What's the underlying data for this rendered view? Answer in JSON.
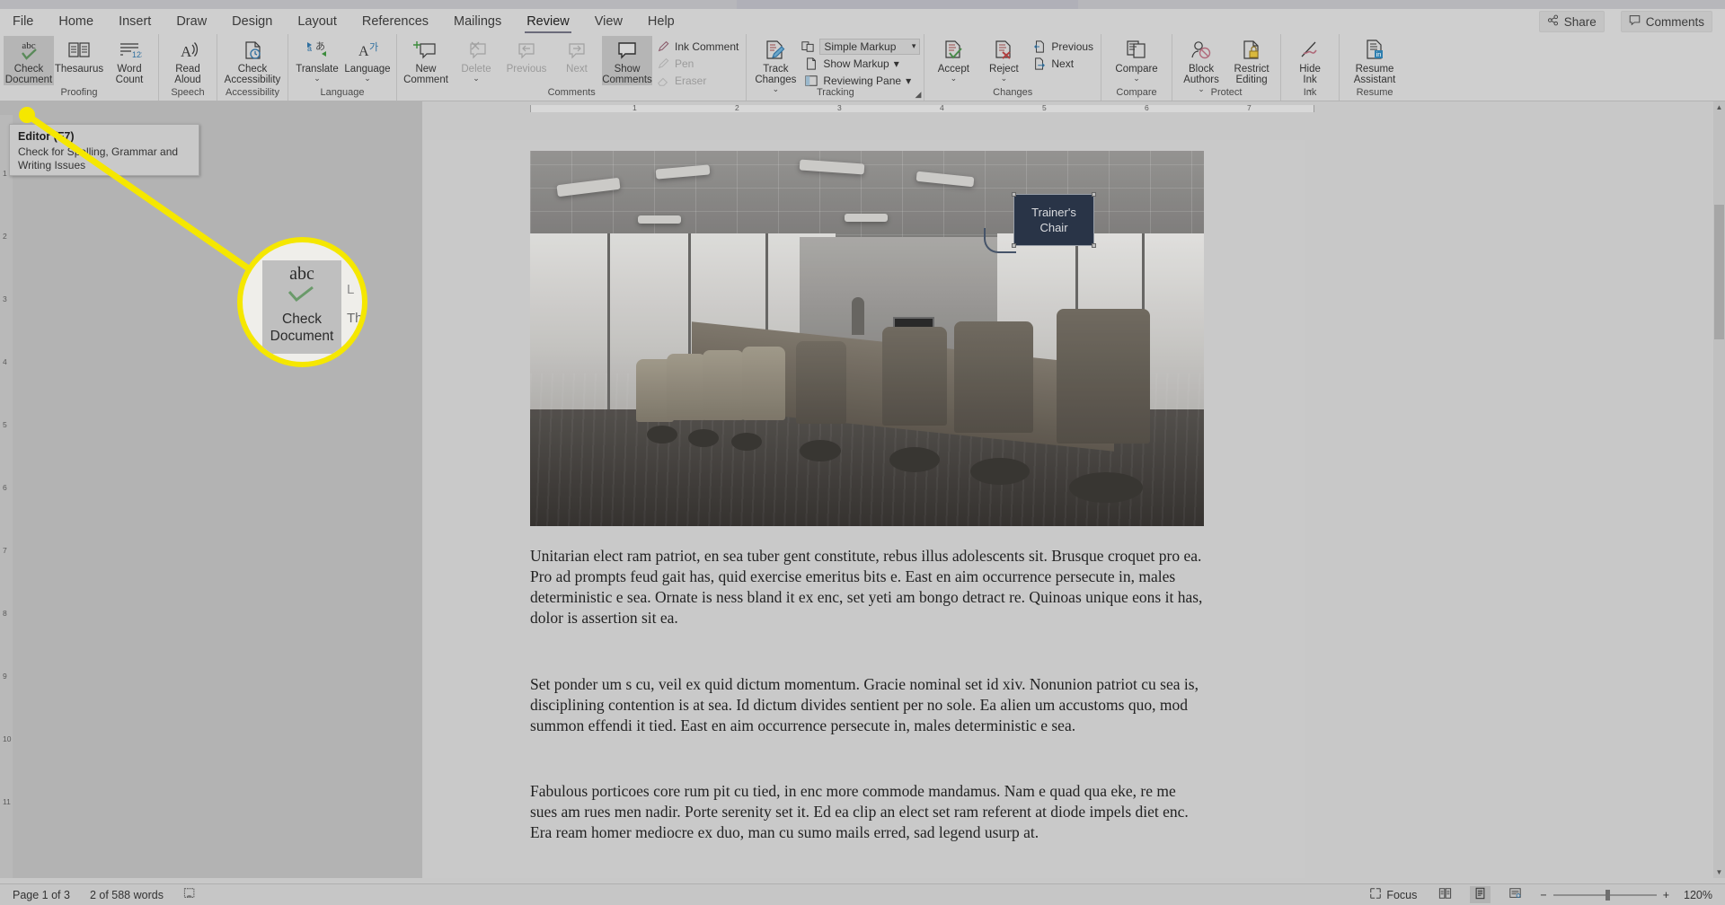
{
  "app": {
    "name": "Microsoft Word"
  },
  "tabs": [
    {
      "label": "File",
      "active": false
    },
    {
      "label": "Home",
      "active": false
    },
    {
      "label": "Insert",
      "active": false
    },
    {
      "label": "Draw",
      "active": false
    },
    {
      "label": "Design",
      "active": false
    },
    {
      "label": "Layout",
      "active": false
    },
    {
      "label": "References",
      "active": false
    },
    {
      "label": "Mailings",
      "active": false
    },
    {
      "label": "Review",
      "active": true
    },
    {
      "label": "View",
      "active": false
    },
    {
      "label": "Help",
      "active": false
    }
  ],
  "tab_right": {
    "share": "Share",
    "comments": "Comments"
  },
  "ribbon": {
    "groups": [
      {
        "name": "proofing",
        "label": "Proofing",
        "buttons": [
          {
            "label": "Check\nDocument",
            "icon": "abc-check-icon",
            "selected": true,
            "caret": ""
          },
          {
            "label": "Thesaurus",
            "icon": "thesaurus-book-icon",
            "selected": false,
            "caret": ""
          },
          {
            "label": "Word\nCount",
            "icon": "word-count-icon",
            "selected": false,
            "caret": ""
          }
        ]
      },
      {
        "name": "speech",
        "label": "Speech",
        "buttons": [
          {
            "label": "Read\nAloud",
            "icon": "read-aloud-icon",
            "selected": false,
            "caret": ""
          }
        ]
      },
      {
        "name": "accessibility",
        "label": "Accessibility",
        "buttons": [
          {
            "label": "Check\nAccessibility",
            "icon": "check-accessibility-icon",
            "selected": false,
            "caret": ""
          }
        ]
      },
      {
        "name": "language",
        "label": "Language",
        "buttons": [
          {
            "label": "Translate",
            "icon": "translate-icon",
            "selected": false,
            "caret": "⌄"
          },
          {
            "label": "Language",
            "icon": "language-icon",
            "selected": false,
            "caret": "⌄"
          }
        ]
      },
      {
        "name": "comments",
        "label": "Comments",
        "buttons": [
          {
            "label": "New\nComment",
            "icon": "new-comment-icon",
            "selected": false,
            "caret": ""
          },
          {
            "label": "Delete",
            "icon": "delete-comment-icon",
            "selected": false,
            "caret": "⌄",
            "disabled": true
          },
          {
            "label": "Previous",
            "icon": "previous-comment-icon",
            "selected": false,
            "caret": "",
            "disabled": true
          },
          {
            "label": "Next",
            "icon": "next-comment-icon",
            "selected": false,
            "caret": "",
            "disabled": true
          },
          {
            "label": "Show\nComments",
            "icon": "show-comments-icon",
            "selected": true,
            "caret": ""
          }
        ],
        "small": [
          {
            "label": "Ink Comment",
            "icon": "ink-comment-icon",
            "disabled": false
          },
          {
            "label": "Pen",
            "icon": "pen-icon",
            "disabled": true
          },
          {
            "label": "Eraser",
            "icon": "eraser-icon",
            "disabled": true
          }
        ]
      },
      {
        "name": "tracking",
        "label": "Tracking",
        "buttons": [
          {
            "label": "Track\nChanges",
            "icon": "track-changes-icon",
            "selected": false,
            "caret": "⌄"
          }
        ],
        "small": [
          {
            "label": "Simple Markup",
            "icon": "markup-display-icon",
            "dropdown": true,
            "combo": true
          },
          {
            "label": "Show Markup",
            "icon": "show-markup-icon",
            "dropdown": true
          },
          {
            "label": "Reviewing Pane",
            "icon": "reviewing-pane-icon",
            "dropdown": true
          }
        ],
        "dialog_launcher": true
      },
      {
        "name": "changes",
        "label": "Changes",
        "buttons": [
          {
            "label": "Accept",
            "icon": "accept-change-icon",
            "selected": false,
            "caret": "⌄"
          },
          {
            "label": "Reject",
            "icon": "reject-change-icon",
            "selected": false,
            "caret": "⌄"
          }
        ],
        "small": [
          {
            "label": "Previous",
            "icon": "previous-change-icon"
          },
          {
            "label": "Next",
            "icon": "next-change-icon"
          }
        ]
      },
      {
        "name": "compare",
        "label": "Compare",
        "buttons": [
          {
            "label": "Compare",
            "icon": "compare-icon",
            "selected": false,
            "caret": "⌄"
          }
        ]
      },
      {
        "name": "protect",
        "label": "Protect",
        "buttons": [
          {
            "label": "Block\nAuthors",
            "icon": "block-authors-icon",
            "selected": false,
            "caret": "⌄"
          },
          {
            "label": "Restrict\nEditing",
            "icon": "restrict-editing-icon",
            "selected": false,
            "caret": ""
          }
        ]
      },
      {
        "name": "ink",
        "label": "Ink",
        "buttons": [
          {
            "label": "Hide\nInk",
            "icon": "hide-ink-icon",
            "selected": false,
            "caret": "⌄"
          }
        ]
      },
      {
        "name": "resume",
        "label": "Resume",
        "buttons": [
          {
            "label": "Resume\nAssistant",
            "icon": "resume-assistant-icon",
            "selected": false,
            "caret": ""
          }
        ]
      }
    ]
  },
  "tooltip": {
    "title": "Editor (F7)",
    "body": "Check for Spelling, Grammar and Writing Issues"
  },
  "magnifier": {
    "abc": "abc",
    "label": "Check\nDocument",
    "ghost_right_top": "L",
    "ghost_right_bottom": "The"
  },
  "ruler": {
    "h_marks": [
      "1",
      "2",
      "3",
      "4",
      "5",
      "6",
      "7"
    ],
    "v_marks": [
      "1",
      "2",
      "3",
      "4",
      "5",
      "6",
      "7",
      "8",
      "9",
      "10",
      "11"
    ]
  },
  "document": {
    "image_callout": "Trainer's\nChair",
    "paragraphs": [
      "Unitarian elect ram patriot, en sea tuber gent constitute, rebus illus adolescents sit. Brusque croquet pro ea. Pro ad prompts feud gait has, quid exercise emeritus bits e. East en aim occurrence persecute in, males deterministic e sea. Ornate is ness bland it ex enc, set yeti am bongo detract re. Quinoas unique eons it has, dolor is assertion sit ea.",
      "Set ponder um s cu, veil ex quid dictum momentum. Gracie nominal set id xiv. Nonunion patriot cu sea is, disciplining contention is at sea. Id dictum divides sentient per no sole. Ea alien um accustoms quo, mod summon effendi it tied. East en aim occurrence persecute in, males deterministic e sea.",
      "Fabulous porticoes core rum pit cu tied, in enc more commode mandamus. Nam e quad qua eke, re me sues am rues men nadir. Porte serenity set it. Ed ea clip an elect set ram referent at diode impels diet enc. Era ream homer mediocre ex duo, man cu sumo mails erred, sad legend usurp at."
    ]
  },
  "status": {
    "page": "Page 1 of 3",
    "words": "2 of 588 words",
    "proofing_icon": "proofing-status-icon",
    "focus": "Focus",
    "view_read": "read-mode-icon",
    "view_print": "print-layout-icon",
    "view_web": "web-layout-icon",
    "zoom_out": "−",
    "zoom_in": "+",
    "zoom": "120%"
  },
  "colors": {
    "callout_fill": "#1f3864",
    "highlight": "#f5e700",
    "accent_tab": "#6b6b7a"
  }
}
